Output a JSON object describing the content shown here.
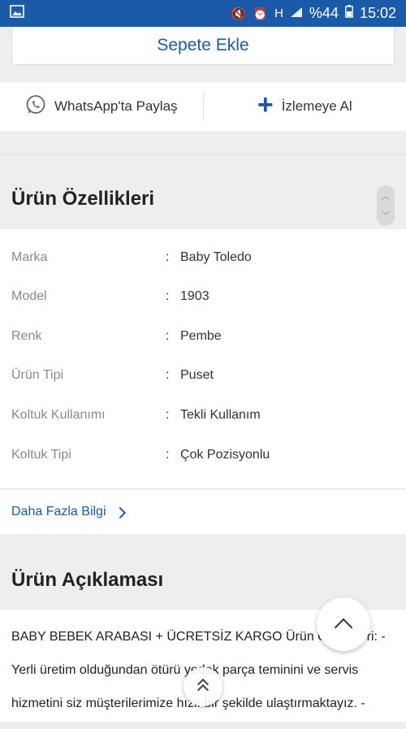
{
  "status_bar": {
    "battery_percent": "%44",
    "time": "15:02",
    "network": "H"
  },
  "actions": {
    "add_to_cart": "Sepete Ekle",
    "whatsapp_share": "WhatsApp'ta Paylaş",
    "watch": "İzlemeye Al"
  },
  "features": {
    "title": "Ürün Özellikleri",
    "rows": [
      {
        "label": "Marka",
        "value": "Baby Toledo"
      },
      {
        "label": "Model",
        "value": "1903"
      },
      {
        "label": "Renk",
        "value": "Pembe"
      },
      {
        "label": "Ürün Tipi",
        "value": "Puset"
      },
      {
        "label": "Koltuk Kullanımı",
        "value": "Tekli Kullanım"
      },
      {
        "label": "Koltuk Tipi",
        "value": "Çok Pozisyonlu"
      }
    ],
    "separator": ":",
    "more_info": "Daha Fazla Bilgi"
  },
  "description": {
    "title": "Ürün Açıklaması",
    "lines": [
      "BABY BEBEK ARABASI + ÜCRETSİZ KARGO   Ürün Özellikleri: -",
      "Yerli üretim olduğundan ötürü yedek parça teminini ve servis",
      "hizmetini siz müşterilerimize hızlı bir şekilde ulaştırmaktayız. -"
    ]
  }
}
